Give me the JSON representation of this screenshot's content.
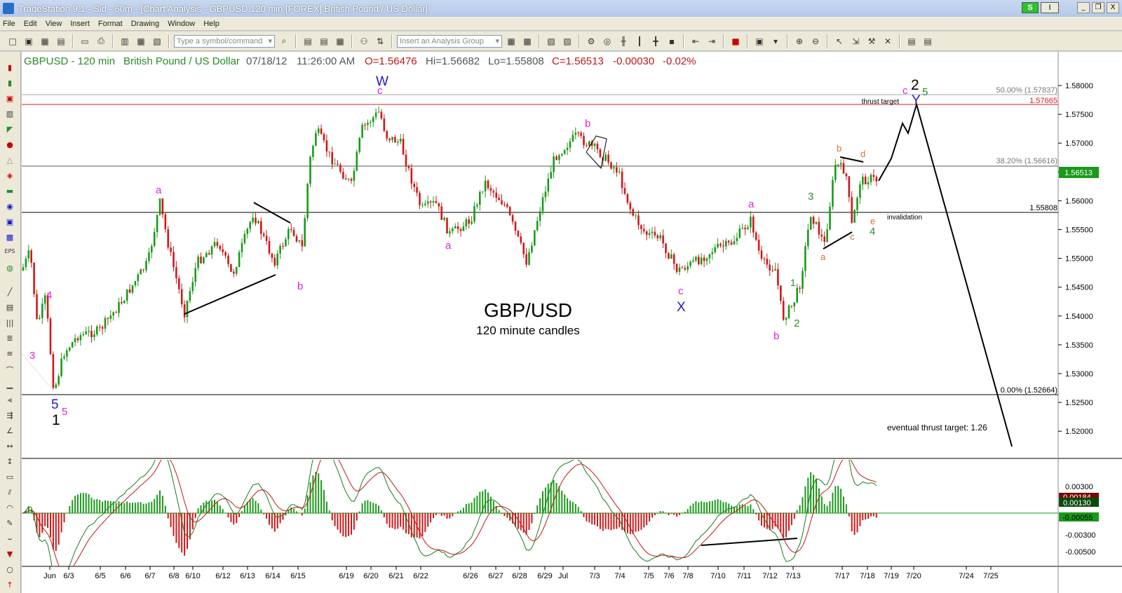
{
  "window": {
    "title": "TradeStation 9.1 - Sid - 60m - [Chart Analysis - GBPUSD 120 min [FOREX] British Pound / US Dollar]",
    "s_button": "S",
    "i_button": "I",
    "minimize": "_",
    "restore": "❐",
    "close": "X"
  },
  "menu": [
    "File",
    "Edit",
    "View",
    "Insert",
    "Format",
    "Drawing",
    "Window",
    "Help"
  ],
  "toolbar": {
    "symbol_placeholder": "Type a symbol/command",
    "analysis_group_placeholder": "Insert an Analysis Group"
  },
  "chart": {
    "symbol": "GBPUSD - 120 min",
    "description": "British Pound / US Dollar",
    "date": "07/18/12",
    "time": "11:26:00 AM",
    "open": "O=1.56476",
    "high": "Hi=1.56682",
    "low": "Lo=1.55808",
    "close": "C=1.56513",
    "change": "-0.00030",
    "change_pct": "-0.02%",
    "center_title": "GBP/USD",
    "center_subtitle": "120 minute candles",
    "price_axis": [
      "1.58000",
      "1.57500",
      "1.57000",
      "1.56500",
      "1.56000",
      "1.55500",
      "1.55000",
      "1.54500",
      "1.54000",
      "1.53500",
      "1.53000",
      "1.52500",
      "1.52000"
    ],
    "last_price": "1.56513",
    "thrust_level": "1.57665",
    "invalidation_level": "1.55808",
    "fib_50": "50.00% (1.57837)",
    "fib_38": "38.20% (1.56616)",
    "fib_0": "0.00% (1.52664)",
    "thrust_target_label": "thrust target",
    "invalidation_label": "invalidation",
    "eventual_label": "eventual thrust target:  1.26",
    "date_axis": [
      "Jun",
      "6/3",
      "6/5",
      "6/6",
      "6/7",
      "6/8",
      "6/10",
      "6/12",
      "6/13",
      "6/14",
      "6/15",
      "6/19",
      "6/20",
      "6/21",
      "6/22",
      "6/26",
      "6/27",
      "6/28",
      "6/29",
      "Jul",
      "7/3",
      "7/4",
      "7/5",
      "7/6",
      "7/8",
      "7/10",
      "7/11",
      "7/12",
      "7/13",
      "7/17",
      "7/18",
      "7/19",
      "7/20",
      "7/24",
      "7/25"
    ],
    "wave_labels": {
      "w_top": "W",
      "c": "c",
      "a": "a",
      "b": "b",
      "x": "X",
      "y": "Y",
      "n1": "1",
      "n2": "2",
      "n3": "3",
      "n4": "4",
      "n5": "5",
      "d": "d",
      "e": "e"
    }
  },
  "macd": {
    "axis": [
      "0.00300",
      "0.00184",
      "0.00130",
      "-0.00055",
      "-0.00300",
      "-0.00500"
    ],
    "tag1": "0.00184",
    "tag2": "0.00130",
    "tag3": "-0.00055"
  },
  "colors": {
    "magenta": "#e020e0",
    "blue": "#1a1acc",
    "green": "#2a8a2a",
    "orange": "#e07020",
    "up_candle": "#1a9a1a",
    "down_candle": "#d01818"
  }
}
